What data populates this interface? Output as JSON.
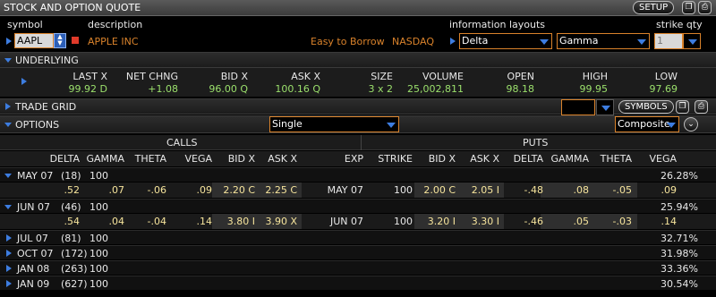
{
  "window": {
    "title": "STOCK AND OPTION QUOTE",
    "setup_label": "SETUP"
  },
  "quote_header": {
    "symbol_label": "symbol",
    "description_label": "description",
    "symbol_value": "AAPL",
    "description_value": "APPLE INC",
    "borrow_status": "Easy to Borrow",
    "exchange": "NASDAQ",
    "info_layouts_label": "information layouts",
    "strike_qty_label": "strike qty",
    "layout1": "Delta",
    "layout2": "Gamma",
    "strike_qty": "1"
  },
  "underlying": {
    "title": "UNDERLYING",
    "headers": [
      "LAST X",
      "NET CHNG",
      "BID X",
      "ASK X",
      "SIZE",
      "VOLUME",
      "OPEN",
      "HIGH",
      "LOW"
    ],
    "values": [
      "99.92 D",
      "+1.08",
      "96.00 Q",
      "100.16 Q",
      "3 x 2",
      "25,002,811",
      "98.18",
      "99.95",
      "97.69"
    ]
  },
  "trade_grid": {
    "title": "TRADE GRID",
    "symbols_label": "SYMBOLS"
  },
  "options": {
    "title": "OPTIONS",
    "spread": "Single",
    "exchange": "Composite",
    "calls_label": "CALLS",
    "puts_label": "PUTS",
    "call_headers": [
      "DELTA",
      "GAMMA",
      "THETA",
      "VEGA",
      "BID X",
      "ASK X"
    ],
    "mid_headers": [
      "EXP",
      "STRIKE"
    ],
    "put_headers": [
      "BID X",
      "ASK X",
      "DELTA",
      "GAMMA",
      "THETA",
      "VEGA"
    ],
    "expanded": [
      {
        "series": "MAY 07",
        "days": "(18)",
        "mult": "100",
        "iv": "26.28%",
        "call": [
          ".52",
          ".07",
          "-.06",
          ".09",
          "2.20 C",
          "2.25 C"
        ],
        "exp": "MAY 07",
        "strike": "100",
        "put": [
          "2.00 C",
          "2.05 I",
          "-.48",
          ".08",
          "-.05",
          ".09"
        ]
      },
      {
        "series": "JUN 07",
        "days": "(46)",
        "mult": "100",
        "iv": "25.94%",
        "call": [
          ".54",
          ".04",
          "-.04",
          ".14",
          "3.80 I",
          "3.90 X"
        ],
        "exp": "JUN 07",
        "strike": "100",
        "put": [
          "3.20 I",
          "3.30 I",
          "-.46",
          ".05",
          "-.03",
          ".14"
        ]
      }
    ],
    "collapsed": [
      {
        "series": "JUL 07",
        "days": "(81)",
        "mult": "100",
        "iv": "32.71%"
      },
      {
        "series": "OCT 07",
        "days": "(172)",
        "mult": "100",
        "iv": "31.98%"
      },
      {
        "series": "JAN 08",
        "days": "(263)",
        "mult": "100",
        "iv": "33.36%"
      },
      {
        "series": "JAN 09",
        "days": "(627)",
        "mult": "100",
        "iv": "30.54%"
      }
    ]
  }
}
